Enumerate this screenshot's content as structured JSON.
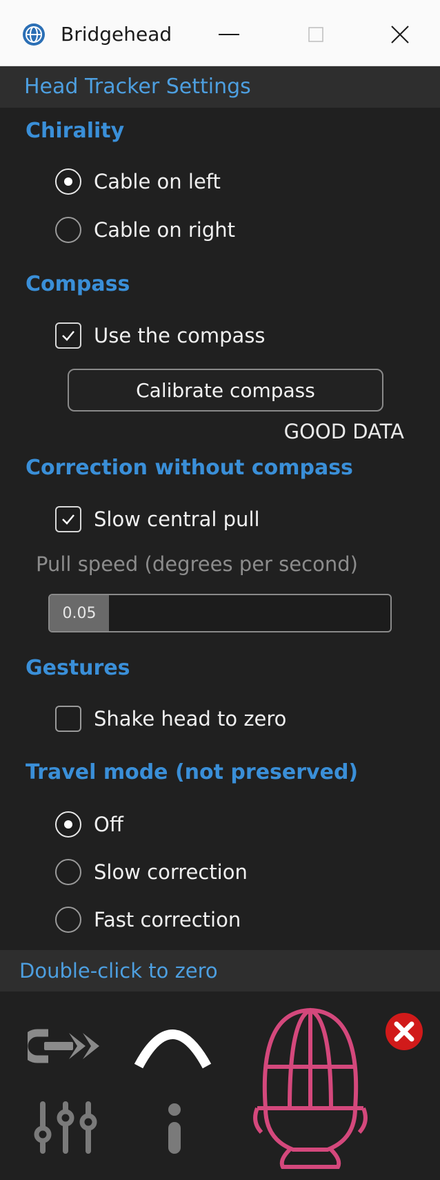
{
  "window": {
    "title": "Bridgehead",
    "icon": "globe-icon",
    "controls": [
      "minimize-icon",
      "maximize-icon",
      "close-icon"
    ]
  },
  "header": {
    "title": "Head Tracker Settings"
  },
  "chirality": {
    "title": "Chirality",
    "options": [
      {
        "label": "Cable on left",
        "selected": true
      },
      {
        "label": "Cable on right",
        "selected": false
      }
    ]
  },
  "compass": {
    "title": "Compass",
    "use_label": "Use the compass",
    "use_checked": true,
    "calibrate_label": "Calibrate compass",
    "status": "GOOD DATA"
  },
  "correction": {
    "title": "Correction without compass",
    "pull_label": "Slow central pull",
    "pull_checked": true,
    "speed_label": "Pull speed (degrees per second)",
    "speed_value": "0.05"
  },
  "gestures": {
    "title": "Gestures",
    "shake_label": "Shake head to zero",
    "shake_checked": false
  },
  "travel": {
    "title": "Travel mode (not preserved)",
    "options": [
      {
        "label": "Off",
        "selected": true
      },
      {
        "label": "Slow correction",
        "selected": false
      },
      {
        "label": "Fast correction",
        "selected": false
      }
    ]
  },
  "footer": {
    "hint": "Double-click to zero",
    "icons": [
      "link-arrow-icon",
      "arc-icon",
      "head-cage-icon",
      "error-icon",
      "sliders-icon",
      "info-icon"
    ],
    "accent_color": "#d4487c",
    "error_color": "#d11a1a"
  }
}
